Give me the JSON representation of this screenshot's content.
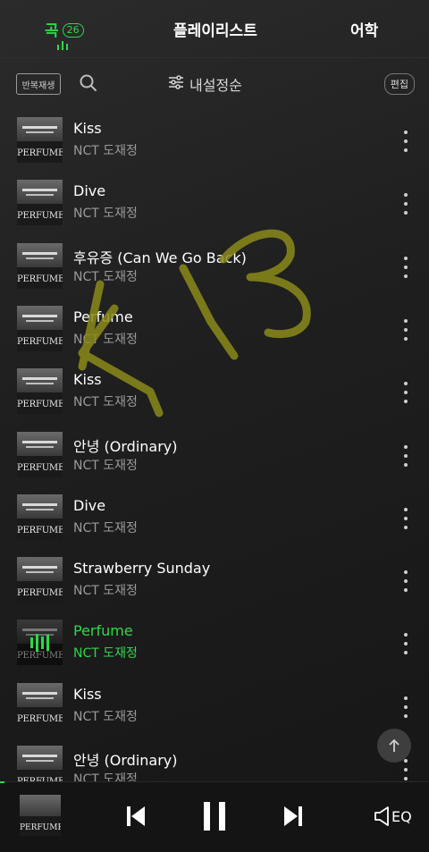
{
  "tabs": [
    {
      "label": "곡",
      "count": "26",
      "active": true
    },
    {
      "label": "플레이리스트",
      "active": false
    },
    {
      "label": "어학",
      "active": false
    }
  ],
  "toolbar": {
    "repeat_label": "반복재생",
    "search_icon": "search-icon",
    "sort_label": "내설정순",
    "sort_icon": "sliders-icon",
    "edit_label": "편집"
  },
  "songs": [
    {
      "title": "Kiss",
      "artist": "NCT 도재정",
      "album_art": "PERFUME"
    },
    {
      "title": "Dive",
      "artist": "NCT 도재정",
      "album_art": "PERFUME"
    },
    {
      "title": "후유증 (Can We Go Back)",
      "artist": "NCT 도재정",
      "album_art": "PERFUME"
    },
    {
      "title": "Perfume",
      "artist": "NCT 도재정",
      "album_art": "PERFUME"
    },
    {
      "title": "Kiss",
      "artist": "NCT 도재정",
      "album_art": "PERFUME"
    },
    {
      "title": "안녕 (Ordinary)",
      "artist": "NCT 도재정",
      "album_art": "PERFUME"
    },
    {
      "title": "Dive",
      "artist": "NCT 도재정",
      "album_art": "PERFUME"
    },
    {
      "title": "Strawberry Sunday",
      "artist": "NCT 도재정",
      "album_art": "PERFUME"
    },
    {
      "title": "Perfume",
      "artist": "NCT 도재정",
      "album_art": "PERFUME",
      "playing": true
    },
    {
      "title": "Kiss",
      "artist": "NCT 도재정",
      "album_art": "PERFUME"
    },
    {
      "title": "안녕 (Ordinary)",
      "artist": "NCT 도재정",
      "album_art": "PERFUME"
    }
  ],
  "player": {
    "album_art": "PERFUME",
    "prev_icon": "skip-previous-icon",
    "pause_icon": "pause-icon",
    "next_icon": "skip-next-icon",
    "eq_label": "EQ"
  },
  "colors": {
    "accent": "#2bd94a",
    "background": "#1e1e1e",
    "secondary_text": "#9a9a9a",
    "scribble": "#8a8a1a"
  }
}
